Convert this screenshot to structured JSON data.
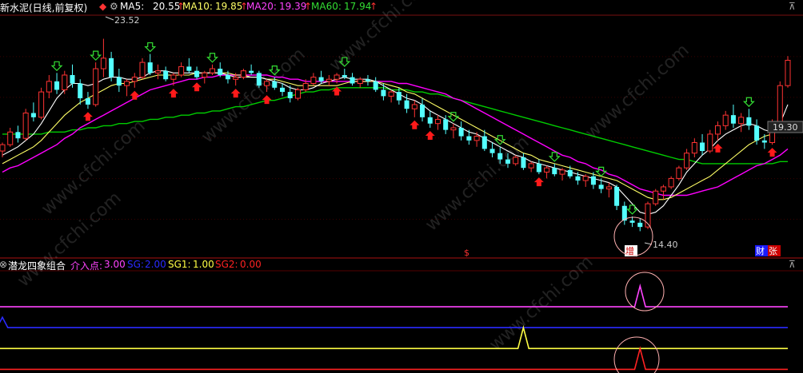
{
  "header": {
    "title": "华新水泥(日线,前复权)",
    "ma5_label": "MA5:",
    "ma5_value": "20.55",
    "ma10_label": "MA10:",
    "ma10_value": "19.85",
    "ma20_label": "MA20:",
    "ma20_value": "19.39",
    "ma60_label": "MA60:",
    "ma60_value": "17.94",
    "up_arrow": "↑"
  },
  "indicator": {
    "name": "潜龙四象组合",
    "l1_label": "介入点:",
    "l1_value": "3.00",
    "l2_label": "SG:",
    "l2_value": "2.00",
    "l3_label": "SG1:",
    "l3_value": "1.00",
    "l4_label": "SG2:",
    "l4_value": "0.00"
  },
  "annotations": {
    "high_label": "23.52",
    "low_label": "14.40",
    "right_label": "19.30",
    "tag_dollar": "$",
    "tag_zeng": "增",
    "tag_cai": "财",
    "tag_zhang": "张"
  },
  "watermark": "www.cfchi.com",
  "colors": {
    "up": "#ff3333",
    "down": "#54ffff",
    "ma5": "#ffffff",
    "ma10": "#ffff66",
    "ma20": "#ff00ff",
    "ma60": "#00cc00",
    "l1": "#ff44ff",
    "l2": "#2a2aff",
    "l3": "#ffff44",
    "l4": "#ff2222"
  },
  "chart_data": [
    {
      "type": "candlestick",
      "title": "华新水泥(日线,前复权)",
      "high": 23.52,
      "low": 14.4,
      "ylim": [
        14.0,
        24.6
      ],
      "candles": [
        [
          18.2,
          18.6,
          17.9,
          18.5
        ],
        [
          18.5,
          19.3,
          18.4,
          19.1
        ],
        [
          19.1,
          19.4,
          18.6,
          18.8
        ],
        [
          18.8,
          20.2,
          18.7,
          20.0
        ],
        [
          20.0,
          20.5,
          19.6,
          19.8
        ],
        [
          19.8,
          21.2,
          19.7,
          21.0
        ],
        [
          21.0,
          21.8,
          20.7,
          21.5
        ],
        [
          21.5,
          21.9,
          20.9,
          21.1
        ],
        [
          21.1,
          22.0,
          20.9,
          21.8
        ],
        [
          21.8,
          22.3,
          21.2,
          21.4
        ],
        [
          21.4,
          21.6,
          20.4,
          20.7
        ],
        [
          20.7,
          21.0,
          20.2,
          20.4
        ],
        [
          20.4,
          22.4,
          20.3,
          22.1
        ],
        [
          22.1,
          23.52,
          21.7,
          22.6
        ],
        [
          22.6,
          22.9,
          21.5,
          21.7
        ],
        [
          21.7,
          22.1,
          21.0,
          21.3
        ],
        [
          21.3,
          21.6,
          20.8,
          21.5
        ],
        [
          21.5,
          21.9,
          21.2,
          21.7
        ],
        [
          21.7,
          22.6,
          21.6,
          22.4
        ],
        [
          22.4,
          22.8,
          21.8,
          21.9
        ],
        [
          21.9,
          22.3,
          21.6,
          22.0
        ],
        [
          22.0,
          22.2,
          21.5,
          21.6
        ],
        [
          21.6,
          21.9,
          21.3,
          21.8
        ],
        [
          21.8,
          22.4,
          21.7,
          22.2
        ],
        [
          22.2,
          22.6,
          21.9,
          22.0
        ],
        [
          22.0,
          22.2,
          21.6,
          21.7
        ],
        [
          21.7,
          22.0,
          21.4,
          21.9
        ],
        [
          21.9,
          22.3,
          21.8,
          22.1
        ],
        [
          22.1,
          22.4,
          21.7,
          21.8
        ],
        [
          21.8,
          22.0,
          21.4,
          21.6
        ],
        [
          21.6,
          21.9,
          21.3,
          21.7
        ],
        [
          21.7,
          22.1,
          21.6,
          22.0
        ],
        [
          22.0,
          22.3,
          21.8,
          21.9
        ],
        [
          21.9,
          22.0,
          21.2,
          21.3
        ],
        [
          21.3,
          21.6,
          21.0,
          21.5
        ],
        [
          21.5,
          21.7,
          21.1,
          21.2
        ],
        [
          21.2,
          21.4,
          20.8,
          21.0
        ],
        [
          21.0,
          21.3,
          20.5,
          20.7
        ],
        [
          20.7,
          21.2,
          20.6,
          21.1
        ],
        [
          21.1,
          21.6,
          21.0,
          21.4
        ],
        [
          21.4,
          21.9,
          21.3,
          21.7
        ],
        [
          21.7,
          22.0,
          21.4,
          21.5
        ],
        [
          21.5,
          21.8,
          21.3,
          21.6
        ],
        [
          21.6,
          21.9,
          21.4,
          21.8
        ],
        [
          21.8,
          22.1,
          21.6,
          21.7
        ],
        [
          21.7,
          21.9,
          21.3,
          21.4
        ],
        [
          21.4,
          21.7,
          21.2,
          21.6
        ],
        [
          21.6,
          21.8,
          21.3,
          21.5
        ],
        [
          21.5,
          21.7,
          21.0,
          21.1
        ],
        [
          21.1,
          21.4,
          20.6,
          20.8
        ],
        [
          20.8,
          21.1,
          20.5,
          21.0
        ],
        [
          21.0,
          21.2,
          20.4,
          20.6
        ],
        [
          20.6,
          20.9,
          20.0,
          20.2
        ],
        [
          20.2,
          20.6,
          19.8,
          20.4
        ],
        [
          20.4,
          20.7,
          19.6,
          19.8
        ],
        [
          19.8,
          20.1,
          19.3,
          19.5
        ],
        [
          19.5,
          19.9,
          19.2,
          19.7
        ],
        [
          19.7,
          19.9,
          19.0,
          19.2
        ],
        [
          19.2,
          19.5,
          18.8,
          19.3
        ],
        [
          19.3,
          19.6,
          18.7,
          18.9
        ],
        [
          18.9,
          19.2,
          18.5,
          18.7
        ],
        [
          18.7,
          19.1,
          18.4,
          18.9
        ],
        [
          18.9,
          19.2,
          18.2,
          18.3
        ],
        [
          18.3,
          18.6,
          17.9,
          18.1
        ],
        [
          18.1,
          18.4,
          17.6,
          17.8
        ],
        [
          17.8,
          18.1,
          17.4,
          17.6
        ],
        [
          17.6,
          18.0,
          17.5,
          17.9
        ],
        [
          17.9,
          18.1,
          17.3,
          17.4
        ],
        [
          17.4,
          17.7,
          17.2,
          17.6
        ],
        [
          17.6,
          17.8,
          17.1,
          17.2
        ],
        [
          17.2,
          17.5,
          16.9,
          17.4
        ],
        [
          17.4,
          17.6,
          17.0,
          17.1
        ],
        [
          17.1,
          17.4,
          16.8,
          17.3
        ],
        [
          17.3,
          17.5,
          16.9,
          17.0
        ],
        [
          17.0,
          17.2,
          16.6,
          16.8
        ],
        [
          16.8,
          17.1,
          16.5,
          17.0
        ],
        [
          17.0,
          17.2,
          16.4,
          16.6
        ],
        [
          16.6,
          16.9,
          16.2,
          16.4
        ],
        [
          16.4,
          16.7,
          16.0,
          16.5
        ],
        [
          16.5,
          16.6,
          15.4,
          15.6
        ],
        [
          15.6,
          15.8,
          14.7,
          14.9
        ],
        [
          14.9,
          15.1,
          14.6,
          14.8
        ],
        [
          14.8,
          15.0,
          14.4,
          14.6
        ],
        [
          14.6,
          15.8,
          14.5,
          15.7
        ],
        [
          15.7,
          16.4,
          15.6,
          16.3
        ],
        [
          16.3,
          16.6,
          15.9,
          16.5
        ],
        [
          16.5,
          17.0,
          16.4,
          16.9
        ],
        [
          16.9,
          17.5,
          16.8,
          17.4
        ],
        [
          17.4,
          18.3,
          17.3,
          18.1
        ],
        [
          18.1,
          18.8,
          17.9,
          18.6
        ],
        [
          18.6,
          19.0,
          18.0,
          18.2
        ],
        [
          18.2,
          19.2,
          18.1,
          19.0
        ],
        [
          19.0,
          19.6,
          18.7,
          19.4
        ],
        [
          19.4,
          20.1,
          19.2,
          19.9
        ],
        [
          19.9,
          20.4,
          19.3,
          19.5
        ],
        [
          19.5,
          20.0,
          19.1,
          19.8
        ],
        [
          19.8,
          20.2,
          19.2,
          19.4
        ],
        [
          19.4,
          19.7,
          18.5,
          18.7
        ],
        [
          18.7,
          19.0,
          18.3,
          18.6
        ],
        [
          18.6,
          19.7,
          18.5,
          19.5
        ],
        [
          19.5,
          21.5,
          19.4,
          21.3
        ],
        [
          21.3,
          22.7,
          21.2,
          22.5
        ]
      ],
      "ma5": [
        18.0,
        18.2,
        18.4,
        18.7,
        19.0,
        19.5,
        20.1,
        20.7,
        21.1,
        21.4,
        21.4,
        21.3,
        21.4,
        21.6,
        21.7,
        21.7,
        21.6,
        21.6,
        21.7,
        21.9,
        22.0,
        22.0,
        21.9,
        21.9,
        21.9,
        21.9,
        21.9,
        21.9,
        21.9,
        21.8,
        21.7,
        21.7,
        21.7,
        21.7,
        21.6,
        21.5,
        21.4,
        21.2,
        21.1,
        21.1,
        21.2,
        21.4,
        21.5,
        21.6,
        21.7,
        21.6,
        21.6,
        21.6,
        21.5,
        21.3,
        21.1,
        20.9,
        20.7,
        20.6,
        20.4,
        20.1,
        19.9,
        19.7,
        19.5,
        19.3,
        19.1,
        19.0,
        18.8,
        18.6,
        18.4,
        18.2,
        18.0,
        17.9,
        17.7,
        17.6,
        17.5,
        17.4,
        17.3,
        17.2,
        17.1,
        17.0,
        16.9,
        16.8,
        16.7,
        16.5,
        16.1,
        15.7,
        15.3,
        15.2,
        15.3,
        15.6,
        16.1,
        16.6,
        17.2,
        17.6,
        18.0,
        18.3,
        18.7,
        19.0,
        19.2,
        19.4,
        19.5,
        19.4,
        19.2,
        19.1,
        19.5,
        20.4
      ],
      "ma10": [
        17.6,
        17.8,
        18.0,
        18.2,
        18.4,
        18.7,
        19.1,
        19.5,
        19.9,
        20.2,
        20.5,
        20.7,
        20.9,
        21.1,
        21.3,
        21.4,
        21.4,
        21.5,
        21.6,
        21.7,
        21.8,
        21.8,
        21.8,
        21.8,
        21.8,
        21.9,
        21.9,
        21.9,
        21.9,
        21.9,
        21.8,
        21.8,
        21.7,
        21.7,
        21.6,
        21.6,
        21.5,
        21.4,
        21.3,
        21.3,
        21.3,
        21.3,
        21.3,
        21.3,
        21.4,
        21.5,
        21.5,
        21.5,
        21.5,
        21.4,
        21.3,
        21.2,
        21.0,
        20.9,
        20.7,
        20.5,
        20.3,
        20.1,
        19.9,
        19.7,
        19.5,
        19.3,
        19.1,
        18.9,
        18.7,
        18.5,
        18.3,
        18.1,
        18.0,
        17.8,
        17.7,
        17.6,
        17.5,
        17.4,
        17.3,
        17.2,
        17.1,
        17.0,
        16.9,
        16.8,
        16.6,
        16.4,
        16.2,
        16.0,
        15.9,
        15.9,
        16.0,
        16.2,
        16.4,
        16.6,
        16.8,
        17.0,
        17.3,
        17.6,
        17.9,
        18.2,
        18.5,
        18.7,
        18.9,
        19.0,
        19.2,
        19.5
      ],
      "ma20": [
        17.2,
        17.4,
        17.5,
        17.7,
        17.9,
        18.1,
        18.3,
        18.5,
        18.8,
        19.0,
        19.3,
        19.5,
        19.7,
        19.9,
        20.1,
        20.3,
        20.5,
        20.7,
        20.9,
        21.1,
        21.2,
        21.3,
        21.4,
        21.5,
        21.6,
        21.6,
        21.7,
        21.7,
        21.8,
        21.8,
        21.8,
        21.8,
        21.8,
        21.8,
        21.8,
        21.7,
        21.7,
        21.6,
        21.6,
        21.5,
        21.5,
        21.5,
        21.5,
        21.5,
        21.5,
        21.5,
        21.5,
        21.5,
        21.5,
        21.5,
        21.5,
        21.4,
        21.4,
        21.3,
        21.2,
        21.1,
        21.0,
        20.9,
        20.7,
        20.6,
        20.4,
        20.2,
        20.0,
        19.8,
        19.6,
        19.4,
        19.2,
        19.0,
        18.8,
        18.6,
        18.4,
        18.2,
        18.0,
        17.9,
        17.7,
        17.6,
        17.4,
        17.3,
        17.1,
        17.0,
        16.8,
        16.6,
        16.4,
        16.3,
        16.2,
        16.1,
        16.1,
        16.1,
        16.1,
        16.2,
        16.3,
        16.4,
        16.5,
        16.7,
        16.9,
        17.1,
        17.3,
        17.5,
        17.6,
        17.8,
        18.0,
        18.3
      ],
      "ma60": [
        19.0,
        19.0,
        19.0,
        19.0,
        19.0,
        19.0,
        19.1,
        19.1,
        19.1,
        19.2,
        19.2,
        19.3,
        19.3,
        19.4,
        19.4,
        19.5,
        19.5,
        19.6,
        19.6,
        19.7,
        19.7,
        19.8,
        19.8,
        19.9,
        19.9,
        20.0,
        20.0,
        20.1,
        20.1,
        20.2,
        20.3,
        20.3,
        20.4,
        20.5,
        20.6,
        20.6,
        20.7,
        20.8,
        20.9,
        21.0,
        21.0,
        21.1,
        21.1,
        21.2,
        21.2,
        21.2,
        21.2,
        21.2,
        21.2,
        21.2,
        21.1,
        21.1,
        21.1,
        21.0,
        21.0,
        20.9,
        20.9,
        20.8,
        20.7,
        20.6,
        20.5,
        20.4,
        20.3,
        20.2,
        20.1,
        20.0,
        19.9,
        19.8,
        19.7,
        19.6,
        19.5,
        19.4,
        19.3,
        19.2,
        19.1,
        19.0,
        18.9,
        18.8,
        18.7,
        18.6,
        18.5,
        18.4,
        18.3,
        18.2,
        18.1,
        18.0,
        17.9,
        17.8,
        17.8,
        17.7,
        17.6,
        17.6,
        17.6,
        17.6,
        17.6,
        17.6,
        17.6,
        17.6,
        17.6,
        17.6,
        17.7,
        17.7
      ]
    },
    {
      "type": "line",
      "title": "潜龙四象组合",
      "series": [
        {
          "name": "介入点",
          "base": 3.0,
          "spikes": [
            [
              82,
              4.0
            ]
          ]
        },
        {
          "name": "SG",
          "base": 2.0,
          "spikes": [
            [
              0,
              2.5
            ]
          ]
        },
        {
          "name": "SG1",
          "base": 1.0,
          "spikes": [
            [
              67,
              2.0
            ]
          ]
        },
        {
          "name": "SG2",
          "base": 0.0,
          "spikes": [
            [
              82,
              1.0
            ]
          ]
        }
      ],
      "ylim": [
        -0.1,
        4.5
      ]
    }
  ]
}
